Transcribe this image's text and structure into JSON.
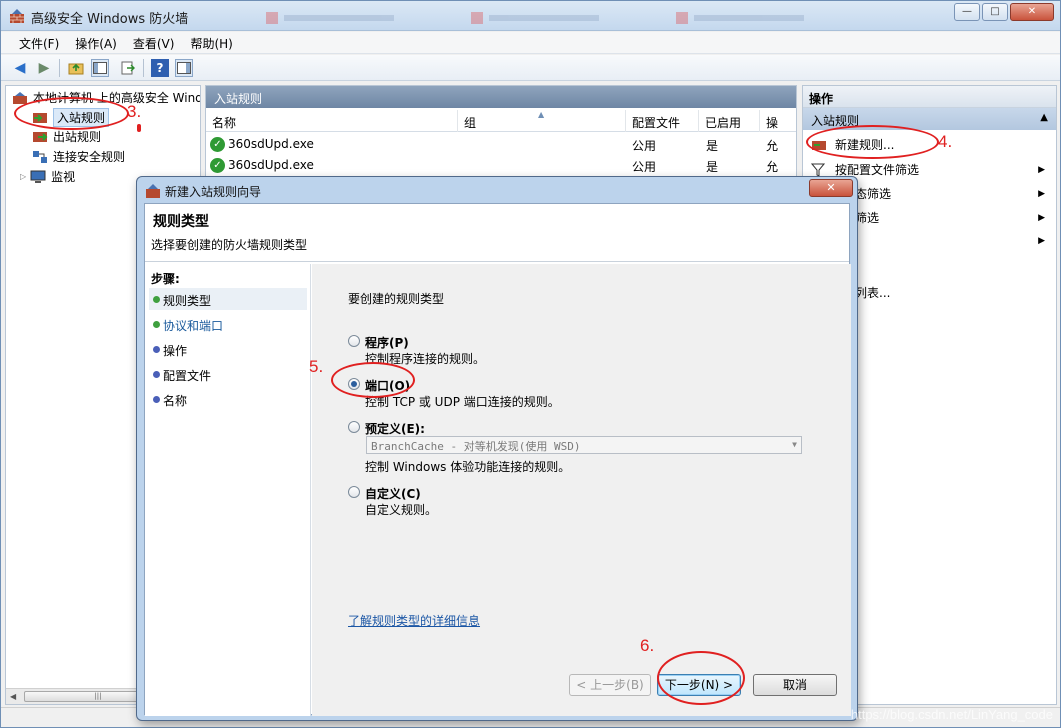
{
  "window": {
    "title": "高级安全 Windows 防火墙",
    "controls": {
      "minimize": "—",
      "maximize": "□",
      "close": "✕"
    }
  },
  "menu": [
    "文件(F)",
    "操作(A)",
    "查看(V)",
    "帮助(H)"
  ],
  "toolbar_icons": [
    "back-arrow-icon",
    "forward-arrow-icon",
    "up-folder-icon",
    "show-hide-tree-icon",
    "export-list-icon",
    "help-icon",
    "show-hide-action-pane-icon"
  ],
  "tree": {
    "root": "本地计算机 上的高级安全 Wind",
    "items": [
      "入站规则",
      "出站规则",
      "连接安全规则",
      "监视"
    ]
  },
  "list": {
    "header": "入站规则",
    "columns": [
      "名称",
      "组",
      "配置文件",
      "已启用",
      "操"
    ],
    "rows": [
      {
        "name": "360sdUpd.exe",
        "group": "",
        "profile": "公用",
        "enabled": "是",
        "action": "允"
      },
      {
        "name": "360sdUpd.exe",
        "group": "",
        "profile": "公用",
        "enabled": "是",
        "action": "允"
      }
    ]
  },
  "actions": {
    "header": "操作",
    "section": "入站规则",
    "items": [
      "新建规则...",
      "按配置文件筛选",
      "态筛选",
      "筛选",
      "",
      "列表..."
    ]
  },
  "dialog": {
    "title": "新建入站规则向导",
    "close": "✕",
    "heading": "规则类型",
    "subheading": "选择要创建的防火墙规则类型",
    "steps_title": "步骤:",
    "steps": [
      "规则类型",
      "协议和端口",
      "操作",
      "配置文件",
      "名称"
    ],
    "prompt": "要创建的规则类型",
    "options": [
      {
        "label": "程序(P)",
        "desc": "控制程序连接的规则。",
        "checked": false
      },
      {
        "label": "端口(O)",
        "desc": "控制 TCP 或 UDP 端口连接的规则。",
        "checked": true
      },
      {
        "label": "预定义(E):",
        "desc": "控制 Windows 体验功能连接的规则。",
        "checked": false
      },
      {
        "label": "自定义(C)",
        "desc": "自定义规则。",
        "checked": false
      }
    ],
    "predefined_value": "BranchCache - 对等机发现(使用 WSD)",
    "learn_more": "了解规则类型的详细信息",
    "buttons": {
      "back": "< 上一步(B)",
      "next": "下一步(N) >",
      "cancel": "取消"
    }
  },
  "annotations": [
    "3.",
    "4.",
    "5.",
    "6."
  ],
  "watermark": "https://blog.csdn.net/LinYang_code",
  "colors": {
    "annotation": "#e02020",
    "accent": "#3c7fb1",
    "link": "#1b56a5"
  }
}
